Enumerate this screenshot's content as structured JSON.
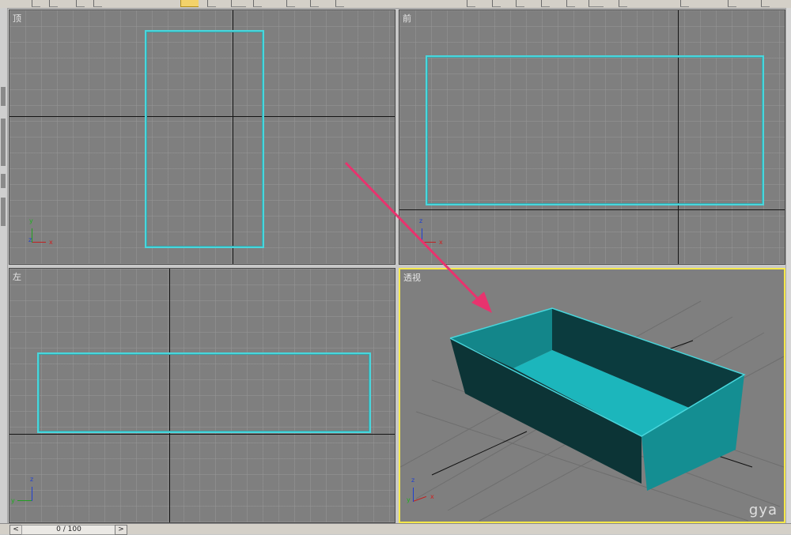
{
  "viewports": {
    "top": {
      "label": "顶"
    },
    "front": {
      "label": "前"
    },
    "left": {
      "label": "左"
    },
    "perspective": {
      "label": "透视"
    }
  },
  "gizmo_labels": {
    "x": "x",
    "y": "y",
    "z": "z"
  },
  "timeline": {
    "position_text": "0 / 100",
    "prev_glyph": "<",
    "next_glyph": ">"
  },
  "watermark": {
    "text": "gya"
  },
  "colors": {
    "viewport_bg": "#7f7f7f",
    "selection_outline": "#49d6dc",
    "active_viewport_border": "#f5e84a",
    "box_face_light": "#1cb6bc",
    "box_face_dark": "#0b3b3e",
    "annotation_arrow": "#e8336e"
  }
}
